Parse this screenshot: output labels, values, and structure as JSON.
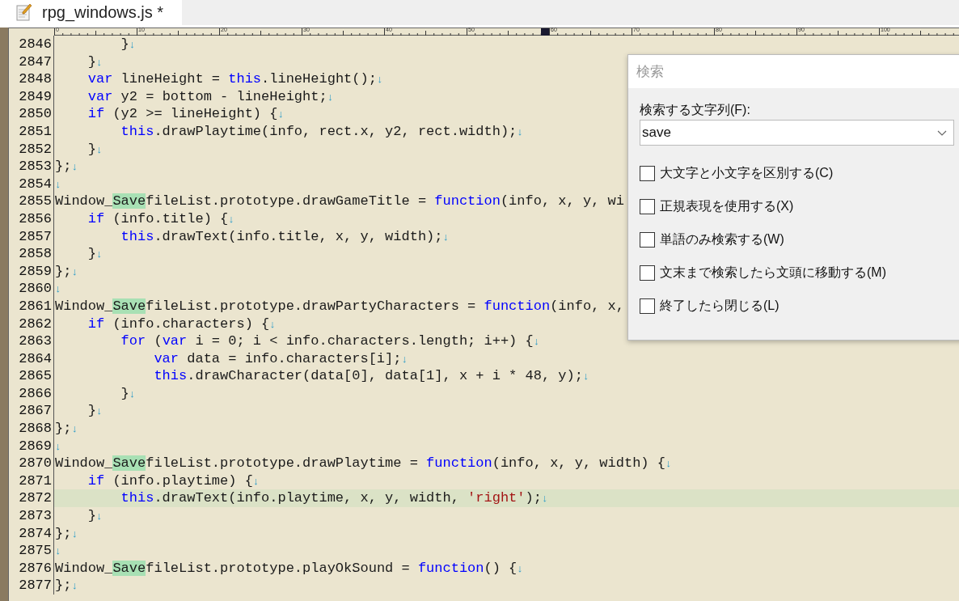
{
  "tab": {
    "title": "rpg_windows.js *",
    "selected": true
  },
  "ruler_labels": [
    "0",
    "10",
    "20",
    "30",
    "40",
    "50",
    "60",
    "70",
    "80",
    "90",
    "100"
  ],
  "lines": [
    {
      "number": "2846",
      "current": false,
      "segments": [
        {
          "kind": "plain",
          "text": "        }"
        },
        {
          "kind": "eol",
          "text": "↓"
        }
      ]
    },
    {
      "number": "2847",
      "current": false,
      "segments": [
        {
          "kind": "plain",
          "text": "    }"
        },
        {
          "kind": "eol",
          "text": "↓"
        }
      ]
    },
    {
      "number": "2848",
      "current": false,
      "segments": [
        {
          "kind": "keyword",
          "text": "    var"
        },
        {
          "kind": "plain",
          "text": " lineHeight = "
        },
        {
          "kind": "keyword",
          "text": "this"
        },
        {
          "kind": "plain",
          "text": ".lineHeight();"
        },
        {
          "kind": "eol",
          "text": "↓"
        }
      ]
    },
    {
      "number": "2849",
      "current": false,
      "segments": [
        {
          "kind": "keyword",
          "text": "    var"
        },
        {
          "kind": "plain",
          "text": " y2 = bottom - lineHeight;"
        },
        {
          "kind": "eol",
          "text": "↓"
        }
      ]
    },
    {
      "number": "2850",
      "current": false,
      "segments": [
        {
          "kind": "keyword",
          "text": "    if"
        },
        {
          "kind": "plain",
          "text": " (y2 >= lineHeight) {"
        },
        {
          "kind": "eol",
          "text": "↓"
        }
      ]
    },
    {
      "number": "2851",
      "current": false,
      "segments": [
        {
          "kind": "keyword",
          "text": "        this"
        },
        {
          "kind": "plain",
          "text": ".drawPlaytime(info, rect.x, y2, rect.width);"
        },
        {
          "kind": "eol",
          "text": "↓"
        }
      ]
    },
    {
      "number": "2852",
      "current": false,
      "segments": [
        {
          "kind": "plain",
          "text": "    }"
        },
        {
          "kind": "eol",
          "text": "↓"
        }
      ]
    },
    {
      "number": "2853",
      "current": false,
      "segments": [
        {
          "kind": "plain",
          "text": "};"
        },
        {
          "kind": "eol",
          "text": "↓"
        }
      ]
    },
    {
      "number": "2854",
      "current": false,
      "segments": [
        {
          "kind": "eol",
          "text": "↓"
        }
      ]
    },
    {
      "number": "2855",
      "current": false,
      "segments": [
        {
          "kind": "plain",
          "text": "Window_"
        },
        {
          "kind": "match",
          "text": "Save"
        },
        {
          "kind": "plain",
          "text": "fileList.prototype.drawGameTitle = "
        },
        {
          "kind": "keyword",
          "text": "function"
        },
        {
          "kind": "plain",
          "text": "(info, x, y, wi"
        }
      ]
    },
    {
      "number": "2856",
      "current": false,
      "segments": [
        {
          "kind": "keyword",
          "text": "    if"
        },
        {
          "kind": "plain",
          "text": " (info.title) {"
        },
        {
          "kind": "eol",
          "text": "↓"
        }
      ]
    },
    {
      "number": "2857",
      "current": false,
      "segments": [
        {
          "kind": "keyword",
          "text": "        this"
        },
        {
          "kind": "plain",
          "text": ".drawText(info.title, x, y, width);"
        },
        {
          "kind": "eol",
          "text": "↓"
        }
      ]
    },
    {
      "number": "2858",
      "current": false,
      "segments": [
        {
          "kind": "plain",
          "text": "    }"
        },
        {
          "kind": "eol",
          "text": "↓"
        }
      ]
    },
    {
      "number": "2859",
      "current": false,
      "segments": [
        {
          "kind": "plain",
          "text": "};"
        },
        {
          "kind": "eol",
          "text": "↓"
        }
      ]
    },
    {
      "number": "2860",
      "current": false,
      "segments": [
        {
          "kind": "eol",
          "text": "↓"
        }
      ]
    },
    {
      "number": "2861",
      "current": false,
      "segments": [
        {
          "kind": "plain",
          "text": "Window_"
        },
        {
          "kind": "match",
          "text": "Save"
        },
        {
          "kind": "plain",
          "text": "fileList.prototype.drawPartyCharacters = "
        },
        {
          "kind": "keyword",
          "text": "function"
        },
        {
          "kind": "plain",
          "text": "(info, x,"
        }
      ]
    },
    {
      "number": "2862",
      "current": false,
      "segments": [
        {
          "kind": "keyword",
          "text": "    if"
        },
        {
          "kind": "plain",
          "text": " (info.characters) {"
        },
        {
          "kind": "eol",
          "text": "↓"
        }
      ]
    },
    {
      "number": "2863",
      "current": false,
      "segments": [
        {
          "kind": "keyword",
          "text": "        for"
        },
        {
          "kind": "plain",
          "text": " ("
        },
        {
          "kind": "keyword",
          "text": "var"
        },
        {
          "kind": "plain",
          "text": " i = 0; i < info.characters.length; i++) {"
        },
        {
          "kind": "eol",
          "text": "↓"
        }
      ]
    },
    {
      "number": "2864",
      "current": false,
      "segments": [
        {
          "kind": "keyword",
          "text": "            var"
        },
        {
          "kind": "plain",
          "text": " data = info.characters[i];"
        },
        {
          "kind": "eol",
          "text": "↓"
        }
      ]
    },
    {
      "number": "2865",
      "current": false,
      "segments": [
        {
          "kind": "keyword",
          "text": "            this"
        },
        {
          "kind": "plain",
          "text": ".drawCharacter(data[0], data[1], x + i * 48, y);"
        },
        {
          "kind": "eol",
          "text": "↓"
        }
      ]
    },
    {
      "number": "2866",
      "current": false,
      "segments": [
        {
          "kind": "plain",
          "text": "        }"
        },
        {
          "kind": "eol",
          "text": "↓"
        }
      ]
    },
    {
      "number": "2867",
      "current": false,
      "segments": [
        {
          "kind": "plain",
          "text": "    }"
        },
        {
          "kind": "eol",
          "text": "↓"
        }
      ]
    },
    {
      "number": "2868",
      "current": false,
      "segments": [
        {
          "kind": "plain",
          "text": "};"
        },
        {
          "kind": "eol",
          "text": "↓"
        }
      ]
    },
    {
      "number": "2869",
      "current": false,
      "segments": [
        {
          "kind": "eol",
          "text": "↓"
        }
      ]
    },
    {
      "number": "2870",
      "current": false,
      "segments": [
        {
          "kind": "plain",
          "text": "Window_"
        },
        {
          "kind": "match",
          "text": "Save"
        },
        {
          "kind": "plain",
          "text": "fileList.prototype.drawPlaytime = "
        },
        {
          "kind": "keyword",
          "text": "function"
        },
        {
          "kind": "plain",
          "text": "(info, x, y, width) {"
        },
        {
          "kind": "eol",
          "text": "↓"
        }
      ]
    },
    {
      "number": "2871",
      "current": false,
      "segments": [
        {
          "kind": "keyword",
          "text": "    if"
        },
        {
          "kind": "plain",
          "text": " (info.playtime) {"
        },
        {
          "kind": "eol",
          "text": "↓"
        }
      ]
    },
    {
      "number": "2872",
      "current": true,
      "segments": [
        {
          "kind": "keyword",
          "text": "        this"
        },
        {
          "kind": "plain",
          "text": ".drawText(info.playtime, x, y, width, "
        },
        {
          "kind": "string",
          "text": "'right'"
        },
        {
          "kind": "plain",
          "text": ");"
        },
        {
          "kind": "eol",
          "text": "↓"
        }
      ]
    },
    {
      "number": "2873",
      "current": false,
      "segments": [
        {
          "kind": "plain",
          "text": "    }"
        },
        {
          "kind": "eol",
          "text": "↓"
        }
      ]
    },
    {
      "number": "2874",
      "current": false,
      "segments": [
        {
          "kind": "plain",
          "text": "};"
        },
        {
          "kind": "eol",
          "text": "↓"
        }
      ]
    },
    {
      "number": "2875",
      "current": false,
      "segments": [
        {
          "kind": "eol",
          "text": "↓"
        }
      ]
    },
    {
      "number": "2876",
      "current": false,
      "segments": [
        {
          "kind": "plain",
          "text": "Window_"
        },
        {
          "kind": "match",
          "text": "Save"
        },
        {
          "kind": "plain",
          "text": "fileList.prototype.playOkSound = "
        },
        {
          "kind": "keyword",
          "text": "function"
        },
        {
          "kind": "plain",
          "text": "() {"
        },
        {
          "kind": "eol",
          "text": "↓"
        }
      ]
    },
    {
      "number": "2877",
      "current": false,
      "segments": [
        {
          "kind": "plain",
          "text": "};"
        },
        {
          "kind": "eol",
          "text": "↓"
        }
      ]
    }
  ],
  "search_dialog": {
    "title": "検索",
    "field_label": "検索する文字列(F):",
    "field_value": "save",
    "options": [
      {
        "label": "大文字と小文字を区別する(C)",
        "checked": false
      },
      {
        "label": "正規表現を使用する(X)",
        "checked": false
      },
      {
        "label": "単語のみ検索する(W)",
        "checked": false
      },
      {
        "label": "文末まで検索したら文頭に移動する(M)",
        "checked": false
      },
      {
        "label": "終了したら閉じる(L)",
        "checked": false
      }
    ]
  }
}
